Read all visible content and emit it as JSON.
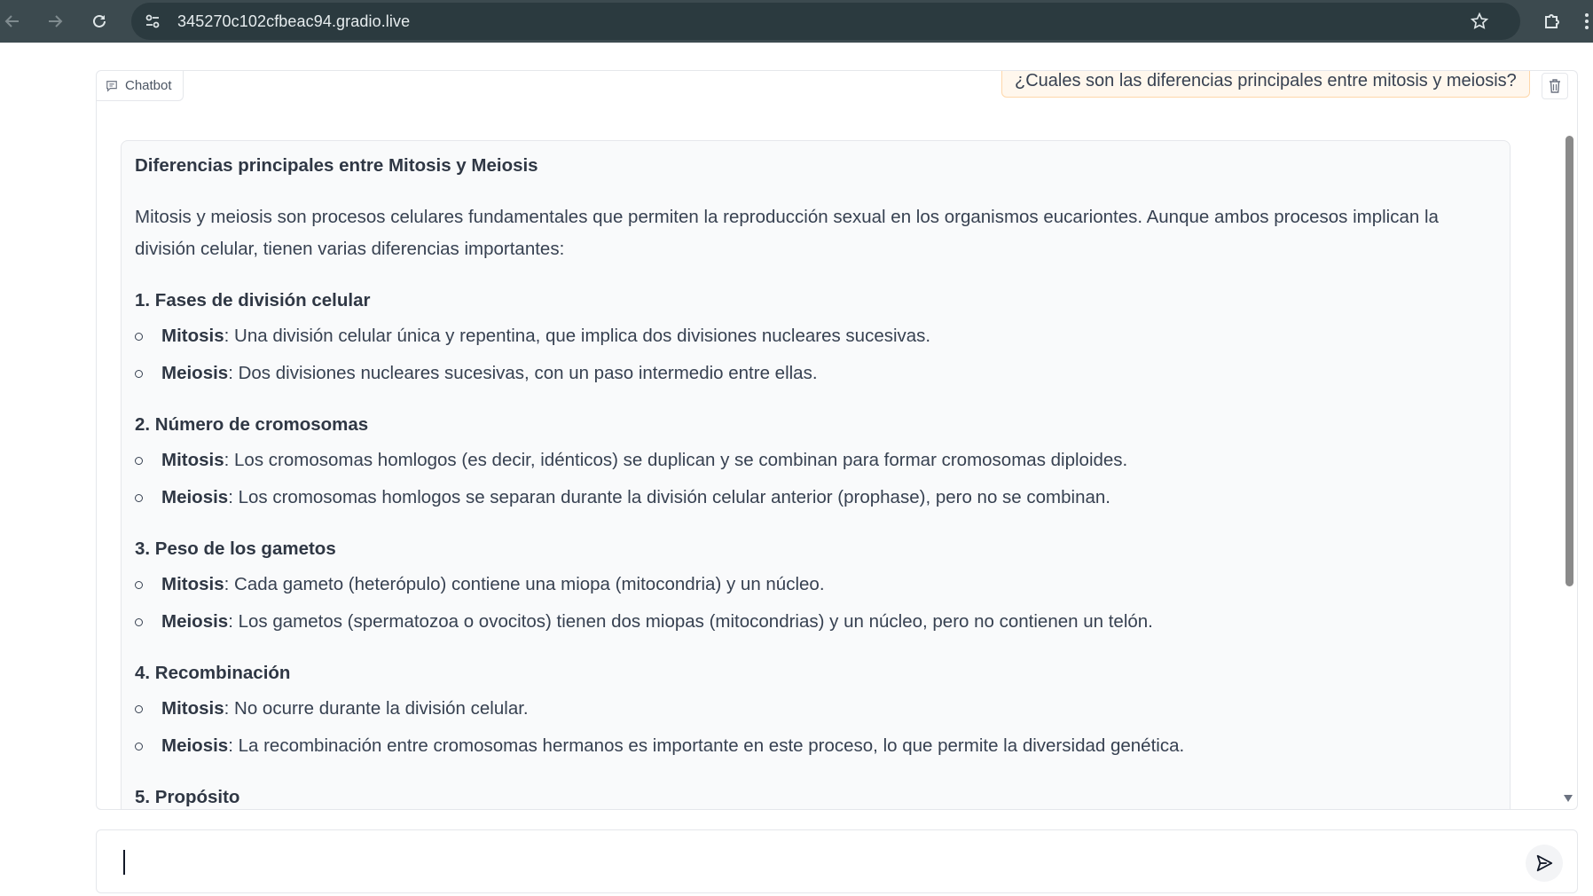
{
  "browser": {
    "url": "345270c102cfbeac94.gradio.live"
  },
  "chatbot": {
    "label": "Chatbot",
    "user_message": "¿Cuales son las diferencias principales entre mitosis y meiosis?",
    "bot_title": "Diferencias principales entre Mitosis y Meiosis",
    "bot_intro": "Mitosis y meiosis son procesos celulares fundamentales que permiten la reproducción sexual en los organismos eucariontes. Aunque ambos procesos implican la división celular, tienen varias diferencias importantes:",
    "sections": [
      {
        "heading": "1. Fases de división celular",
        "items": [
          {
            "term": "Mitosis",
            "text": ": Una división celular única y repentina, que implica dos divisiones nucleares sucesivas."
          },
          {
            "term": "Meiosis",
            "text": ": Dos divisiones nucleares sucesivas, con un paso intermedio entre ellas."
          }
        ]
      },
      {
        "heading": "2. Número de cromosomas",
        "items": [
          {
            "term": "Mitosis",
            "text": ": Los cromosomas homlogos (es decir, idénticos) se duplican y se combinan para formar cromosomas diploides."
          },
          {
            "term": "Meiosis",
            "text": ": Los cromosomas homlogos se separan durante la división celular anterior (prophase), pero no se combinan."
          }
        ]
      },
      {
        "heading": "3. Peso de los gametos",
        "items": [
          {
            "term": "Mitosis",
            "text": ": Cada gameto (heterópulo) contiene una miopa (mitocondria) y un núcleo."
          },
          {
            "term": "Meiosis",
            "text": ": Los gametos (spermatozoa o ovocitos) tienen dos miopas (mitocondrias) y un núcleo, pero no contienen un telón."
          }
        ]
      },
      {
        "heading": "4. Recombinación",
        "items": [
          {
            "term": "Mitosis",
            "text": ": No ocurre durante la división celular."
          },
          {
            "term": "Meiosis",
            "text": ": La recombinación entre cromosomas hermanos es importante en este proceso, lo que permite la diversidad genética."
          }
        ]
      },
      {
        "heading": "5. Propósito",
        "items": []
      }
    ]
  },
  "input": {
    "value": "",
    "placeholder": ""
  },
  "icons": {
    "back": "arrow-left-icon",
    "forward": "arrow-right-icon",
    "reload": "reload-icon",
    "site_info": "tune-icon",
    "bookmark": "star-icon",
    "extensions": "puzzle-icon",
    "chat": "chat-bubble-icon",
    "trash": "trash-icon",
    "send": "send-icon",
    "scroll_down": "chevron-down-icon"
  }
}
